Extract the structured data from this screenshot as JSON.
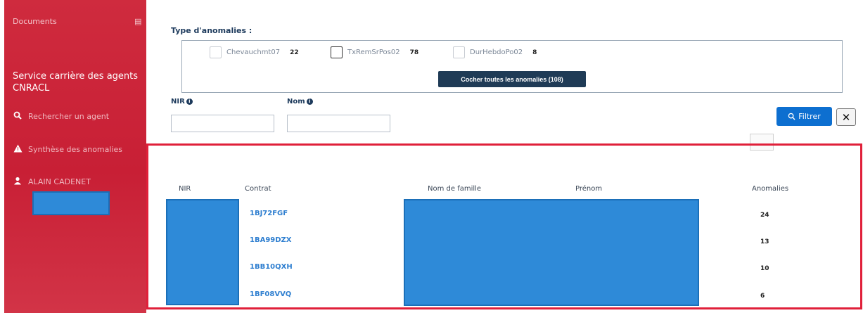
{
  "sidebar": {
    "documents_label": "Documents",
    "service_title": "Service carrière des agents CNRACL",
    "items": [
      {
        "label": "Rechercher un agent",
        "icon": "search-icon"
      },
      {
        "label": "Synthèse des anomalies",
        "icon": "warning-icon"
      },
      {
        "label": "ALAIN CADENET",
        "icon": "user-icon"
      }
    ],
    "brand_color": "#cf2b3e"
  },
  "filters": {
    "type_label": "Type d'anomalies :",
    "anomalies": [
      {
        "name": "Chevauchmt07",
        "count": "22",
        "checked": false
      },
      {
        "name": "TxRemSrPos02",
        "count": "78",
        "checked": false
      },
      {
        "name": "DurHebdoPo02",
        "count": "8",
        "checked": false
      }
    ],
    "check_all_label": "Cocher toutes les anomalies (108)",
    "nir_label": "NIR",
    "nom_label": "Nom",
    "nir_value": "",
    "nom_value": "",
    "filter_button": "Filtrer",
    "clear_button": "✕"
  },
  "table": {
    "headers": {
      "nir": "NIR",
      "contrat": "Contrat",
      "nom_famille": "Nom de famille",
      "prenom": "Prénom",
      "anomalies": "Anomalies"
    },
    "rows": [
      {
        "contrat": "1BJ72FGF",
        "anomalies": "24"
      },
      {
        "contrat": "1BA99DZX",
        "anomalies": "13"
      },
      {
        "contrat": "1BB10QXH",
        "anomalies": "10"
      },
      {
        "contrat": "1BF08VVQ",
        "anomalies": "6"
      }
    ]
  },
  "colors": {
    "accent": "#0d6fd0",
    "highlight": "#e0203a",
    "redaction": "#2e8ad8"
  }
}
